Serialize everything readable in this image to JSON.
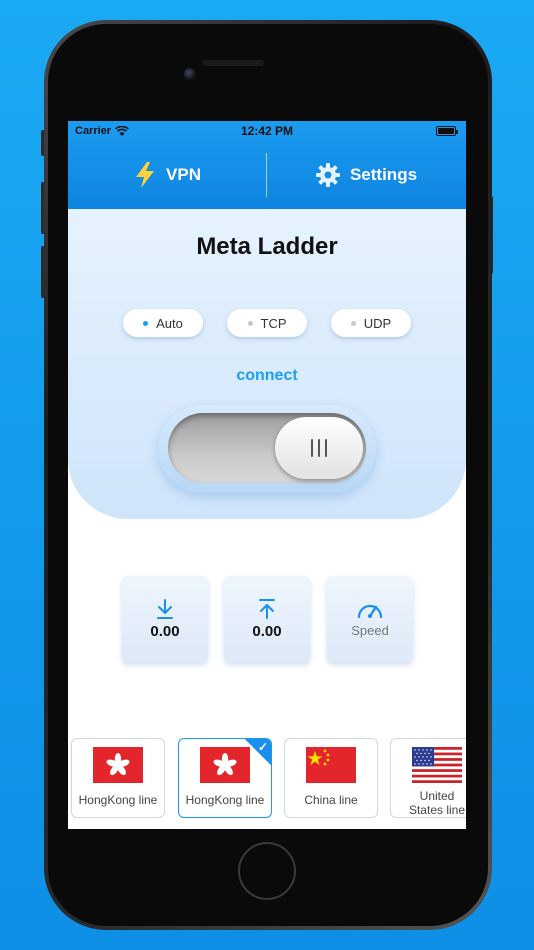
{
  "status_bar": {
    "carrier": "Carrier",
    "time": "12:42 PM"
  },
  "tabs": [
    {
      "label": "VPN",
      "icon": "lightning-icon",
      "color": "#ffd23a"
    },
    {
      "label": "Settings",
      "icon": "gear-icon"
    }
  ],
  "title": "Meta Ladder",
  "modes": [
    {
      "label": "Auto",
      "active": true
    },
    {
      "label": "TCP",
      "active": false
    },
    {
      "label": "UDP",
      "active": false
    }
  ],
  "connect_label": "connect",
  "toggle": {
    "state": "off"
  },
  "stats": [
    {
      "icon": "download-icon",
      "value": "0.00"
    },
    {
      "icon": "upload-icon",
      "value": "0.00"
    },
    {
      "icon": "speedometer-icon",
      "label": "Speed"
    }
  ],
  "lines": [
    {
      "label": "HongKong line",
      "flag": "hong-kong",
      "selected": false
    },
    {
      "label": "HongKong line",
      "flag": "hong-kong",
      "selected": true
    },
    {
      "label": "China line",
      "flag": "china",
      "selected": false
    },
    {
      "label": "United States line",
      "flag": "united-states",
      "selected": false
    }
  ],
  "colors": {
    "accent": "#1a9bf0",
    "header": "#1b9cf0",
    "flag_red": "#e3262c"
  },
  "check_mark": "✓"
}
